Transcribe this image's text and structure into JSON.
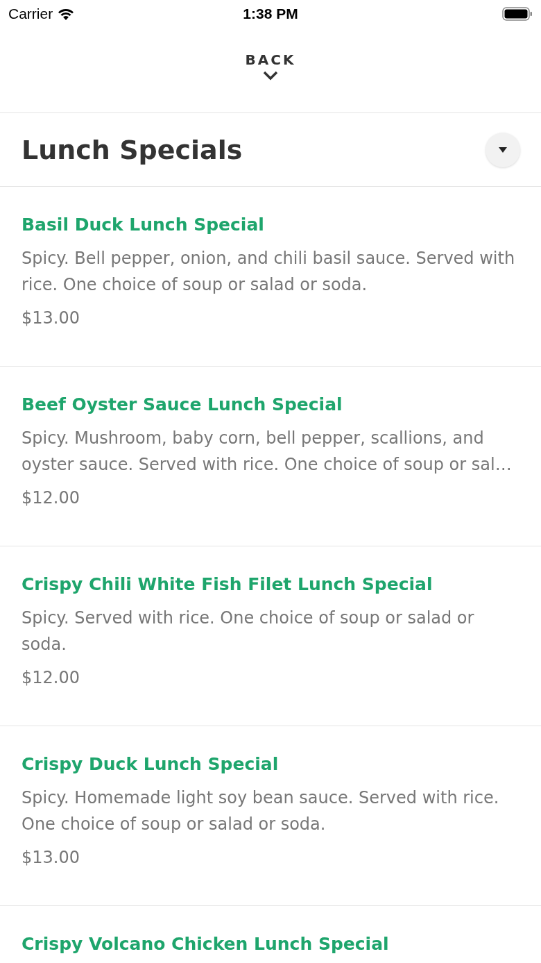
{
  "status_bar": {
    "carrier": "Carrier",
    "time": "1:38 PM"
  },
  "header": {
    "back_label": "BACK"
  },
  "section": {
    "title": "Lunch Specials"
  },
  "items": [
    {
      "name": "Basil Duck Lunch Special",
      "description": "Spicy. Bell pepper, onion, and chili basil sauce. Served with rice. One choice of soup or salad or soda.",
      "price": "$13.00"
    },
    {
      "name": "Beef Oyster Sauce Lunch Special",
      "description": "Spicy. Mushroom, baby corn, bell pepper, scallions, and oyster sauce. Served with rice. One choice of soup or sal…",
      "price": "$12.00"
    },
    {
      "name": "Crispy Chili White Fish Filet Lunch Special",
      "description": "Spicy. Served with rice. One choice of soup or salad or soda.",
      "price": "$12.00"
    },
    {
      "name": "Crispy Duck Lunch Special",
      "description": "Spicy. Homemade light soy bean sauce. Served with rice. One choice of soup or salad or soda.",
      "price": "$13.00"
    },
    {
      "name": "Crispy Volcano Chicken Lunch Special"
    }
  ]
}
